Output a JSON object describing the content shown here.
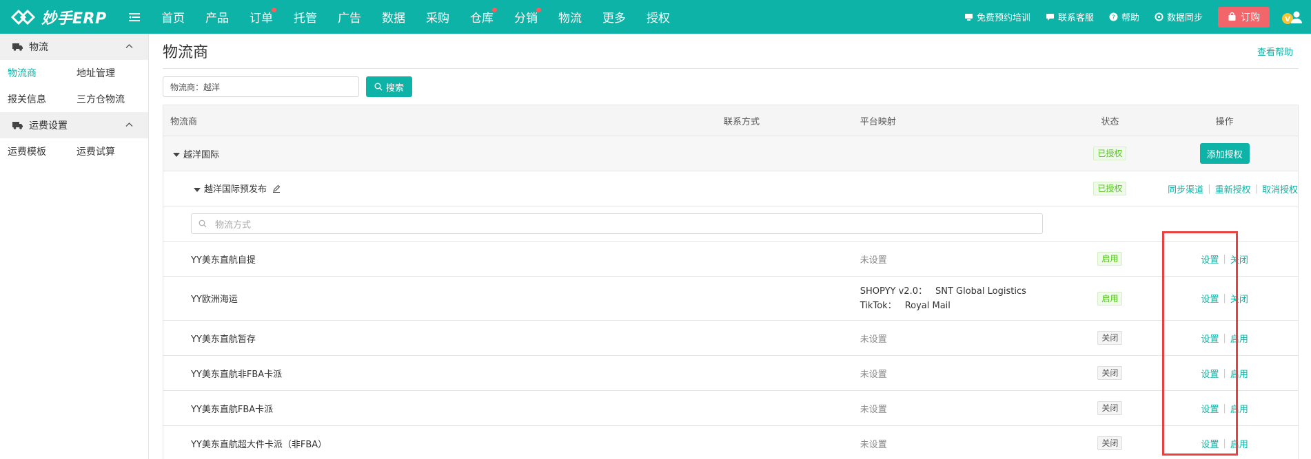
{
  "topbar": {
    "logo_text": "妙手ERP",
    "nav": [
      {
        "label": "首页",
        "dot": false
      },
      {
        "label": "产品",
        "dot": false
      },
      {
        "label": "订单",
        "dot": true
      },
      {
        "label": "托管",
        "dot": false
      },
      {
        "label": "广告",
        "dot": false
      },
      {
        "label": "数据",
        "dot": false
      },
      {
        "label": "采购",
        "dot": false
      },
      {
        "label": "仓库",
        "dot": true
      },
      {
        "label": "分销",
        "dot": true
      },
      {
        "label": "物流",
        "dot": false
      },
      {
        "label": "更多",
        "dot": false
      },
      {
        "label": "授权",
        "dot": false
      }
    ],
    "tools": {
      "training": "免费预约培训",
      "support": "联系客服",
      "help": "帮助",
      "sync": "数据同步",
      "order": "订购"
    },
    "colors": {
      "bar": "#0db3a6",
      "order": "#f2656b"
    }
  },
  "sidebar": {
    "groups": [
      {
        "label": "物流",
        "icon": "truck-icon",
        "links": [
          [
            "物流商",
            "地址管理"
          ],
          [
            "报关信息",
            "三方仓物流"
          ]
        ],
        "active": "物流商"
      },
      {
        "label": "运费设置",
        "icon": "truck-icon",
        "links": [
          [
            "运费模板",
            "运费试算"
          ]
        ]
      }
    ]
  },
  "main": {
    "title": "物流商",
    "help": "查看帮助",
    "search": {
      "value": "物流商：越洋",
      "button": "搜索"
    },
    "table": {
      "headers": {
        "name": "物流商",
        "contact": "联系方式",
        "mapping": "平台映射",
        "status": "状态",
        "actions": "操作"
      },
      "group": {
        "name": "越洋国际",
        "status": "已授权",
        "action": "添加授权"
      },
      "account": {
        "name": "越洋国际预发布",
        "status": "已授权",
        "actions": [
          "同步渠道",
          "重新授权",
          "取消授权"
        ]
      },
      "method_placeholder": "物流方式",
      "rows": [
        {
          "name": "YY美东直航自提",
          "mapping": "未设置",
          "status": "启用",
          "set": "设置",
          "toggle": "关闭"
        },
        {
          "name": "YY欧洲海运",
          "mapping_lines": [
            [
              "SHOPYY v2.0：",
              "SNT Global Logistics"
            ],
            [
              "TikTok：",
              "Royal Mail"
            ]
          ],
          "status": "启用",
          "set": "设置",
          "toggle": "关闭"
        },
        {
          "name": "YY美东直航暂存",
          "mapping": "未设置",
          "status": "关闭",
          "set": "设置",
          "toggle": "启用"
        },
        {
          "name": "YY美东直航非FBA卡派",
          "mapping": "未设置",
          "status": "关闭",
          "set": "设置",
          "toggle": "启用"
        },
        {
          "name": "YY美东直航FBA卡派",
          "mapping": "未设置",
          "status": "关闭",
          "set": "设置",
          "toggle": "启用"
        },
        {
          "name": "YY美东直航超大件卡派（非FBA）",
          "mapping": "未设置",
          "status": "关闭",
          "set": "设置",
          "toggle": "启用"
        }
      ]
    }
  }
}
